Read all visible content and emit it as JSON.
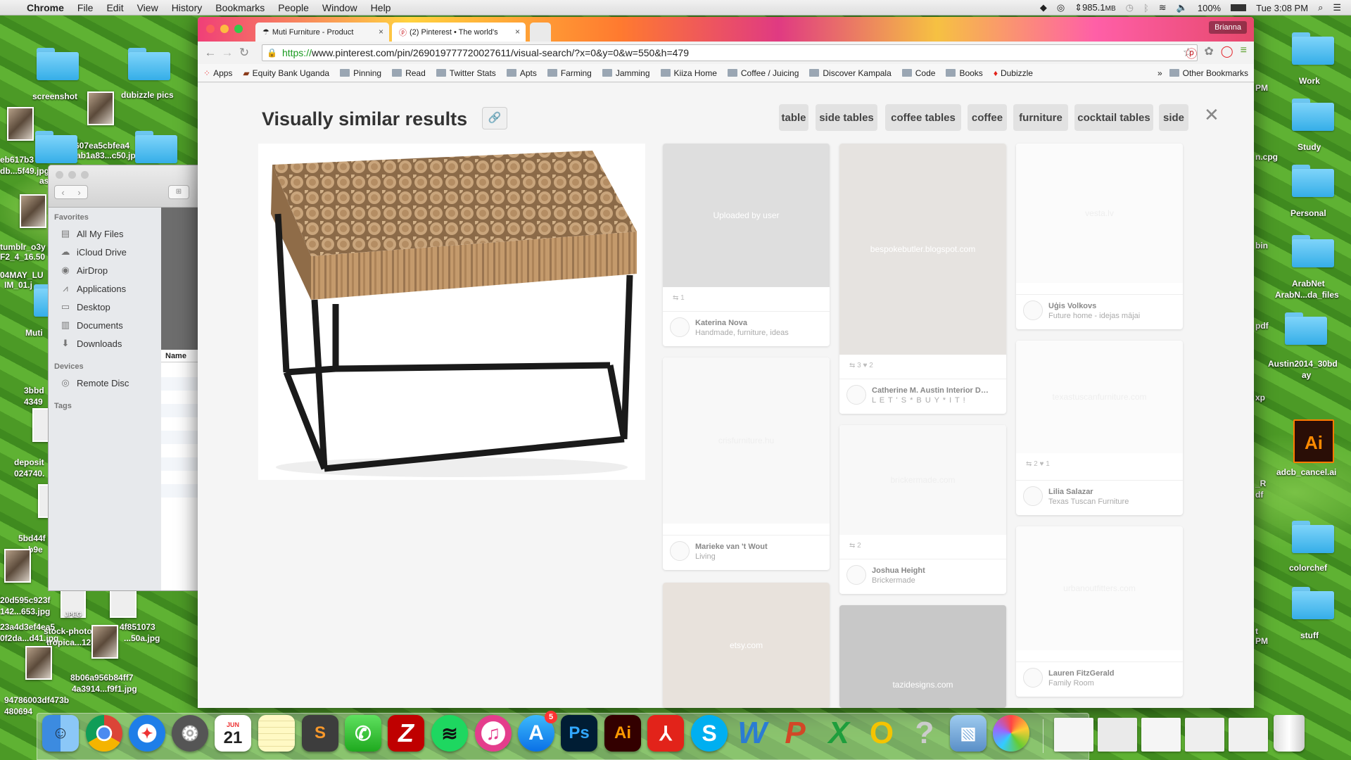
{
  "menubar": {
    "app": "Chrome",
    "items": [
      "File",
      "Edit",
      "View",
      "History",
      "Bookmarks",
      "People",
      "Window",
      "Help"
    ],
    "memory": "985.1",
    "memory_unit": "MB",
    "battery": "100%",
    "clock": "Tue 3:08 PM"
  },
  "desktop": {
    "left_labels": [
      "screenshot",
      "dubizzle pics",
      "b3607ea5cbfea4",
      "ab1a83...c50.jpg",
      "eb617b3",
      "db...5f49.jpg",
      "as",
      "tumblr_o3y",
      "F2_4_16.50",
      "04MAY_LU",
      "IM_01.j",
      "Muti",
      "3bbd",
      "4349",
      "deposit",
      "024740.",
      "5bd44f",
      "b9e",
      "20d595c923f",
      "142...653.jpg",
      "JPEG",
      "23a4d3ef4ea5",
      "0f2da...d41.jpg",
      "stock-photo-",
      "tropica...124.jpg",
      "4f851073",
      "...50a.jpg",
      "8b06a956b84ff7",
      "4a3914...f9f1.jpg",
      "94786003df473b",
      "480694"
    ],
    "right_labels": [
      "Work",
      "Study",
      "Personal",
      "ArabNet",
      "ArabN...da_files",
      "Austin2014_30bd",
      "ay",
      "adcb_cancel.ai",
      "colorchef",
      "stuff"
    ],
    "right_edge_fragments": [
      "PM",
      "n.cpg",
      "bin",
      "pdf",
      "xp",
      "_R",
      "df",
      "t",
      "PM"
    ]
  },
  "finder": {
    "favorites_title": "Favorites",
    "favorites": [
      {
        "label": "All My Files",
        "icon": "files-icon"
      },
      {
        "label": "iCloud Drive",
        "icon": "cloud-icon"
      },
      {
        "label": "AirDrop",
        "icon": "airdrop-icon"
      },
      {
        "label": "Applications",
        "icon": "applications-icon"
      },
      {
        "label": "Desktop",
        "icon": "desktop-icon"
      },
      {
        "label": "Documents",
        "icon": "documents-icon"
      },
      {
        "label": "Downloads",
        "icon": "downloads-icon"
      }
    ],
    "devices_title": "Devices",
    "devices": [
      {
        "label": "Remote Disc",
        "icon": "disc-icon"
      }
    ],
    "tags_title": "Tags",
    "column_header": "Name"
  },
  "chrome": {
    "tabs": [
      {
        "title": "Muti Furniture - Product",
        "icon": "umbrella-icon"
      },
      {
        "title": "(2) Pinterest • The world's",
        "icon": "pinterest-icon"
      }
    ],
    "profile": "Brianna",
    "url_scheme": "https://",
    "url_host": "www.pinterest.com",
    "url_path": "/pin/269019777720027611/visual-search/?x=0&y=0&w=550&h=479",
    "bookmarks": [
      "Apps",
      "Equity Bank Uganda",
      "Pinning",
      "Read",
      "Twitter Stats",
      "Apts",
      "Farming",
      "Jamming",
      "Kiiza Home",
      "Coffee / Juicing",
      "Discover Kampala",
      "Code",
      "Books",
      "Dubizzle"
    ],
    "bookmarks_overflow": "»",
    "other_bookmarks": "Other Bookmarks"
  },
  "modal": {
    "title": "Visually similar results",
    "chips": [
      "table",
      "side tables",
      "coffee tables",
      "coffee",
      "furniture",
      "cocktail tables",
      "side"
    ],
    "pins": [
      {
        "source": "Uploaded by user",
        "stats": "⇆ 1",
        "name": "Katerina Nova",
        "board": "Handmade, furniture, ideas"
      },
      {
        "source": "bespokebutler.blogspot.com",
        "stats": "⇆ 3  ♥ 2",
        "name": "Catherine M. Austin Interior Desi...",
        "board": "L E T ' S * B U Y * I T !"
      },
      {
        "source": "vesta.lv",
        "stats": "",
        "name": "Uģis Volkovs",
        "board": "Future home - idejas mājai"
      },
      {
        "source": "crisfurniture.hu",
        "stats": "",
        "name": "Marieke van 't Wout",
        "board": "Living"
      },
      {
        "source": "brickermade.com",
        "stats": "⇆ 2",
        "name": "Joshua Height",
        "board": "Brickermade"
      },
      {
        "source": "texastuscanfurniture.com",
        "stats": "⇆ 2  ♥ 1",
        "name": "Lilia Salazar",
        "board": "Texas Tuscan Furniture"
      },
      {
        "source": "urbanoutfitters.com",
        "stats": "",
        "name": "Lauren FitzGerald",
        "board": "Family Room"
      },
      {
        "source": "etsy.com",
        "stats": "",
        "name": "",
        "board": ""
      },
      {
        "source": "tazidesigns.com",
        "stats": "",
        "name": "",
        "board": ""
      }
    ]
  },
  "dock": {
    "calendar_month": "JUN",
    "calendar_day": "21",
    "appstore_badge": "5",
    "apps": [
      "Finder",
      "Chrome",
      "Safari",
      "System Preferences",
      "Calendar",
      "Notes",
      "Sublime Text",
      "FaceTime",
      "FileZilla",
      "Spotify",
      "iTunes",
      "App Store",
      "Photoshop",
      "Illustrator",
      "Acrobat",
      "Skype",
      "Word",
      "PowerPoint",
      "Excel",
      "Outlook",
      "Help",
      "Preview",
      "Photos",
      "Trash"
    ]
  }
}
